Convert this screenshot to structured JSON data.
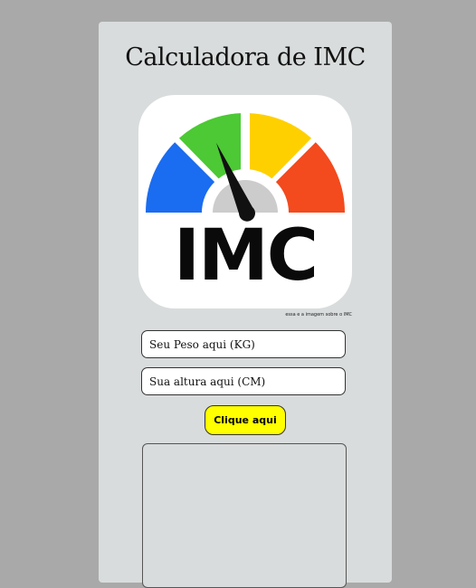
{
  "page": {
    "title": "Calculadora de IMC",
    "logo_text": "IMC",
    "logo_caption": "essa e a imagem sobre o IMC"
  },
  "form": {
    "weight_placeholder": "Seu Peso aqui (KG)",
    "height_placeholder": "Sua altura aqui (CM)",
    "weight_value": "",
    "height_value": "",
    "submit_label": "Clique aqui"
  },
  "result": {
    "text": ""
  },
  "colors": {
    "background": "#a9a9a9",
    "card": "#d9dcdc",
    "button": "#ffff00",
    "gauge_blue": "#1a6cf0",
    "gauge_green": "#4cc934",
    "gauge_yellow": "#ffd000",
    "gauge_red": "#f34a1e"
  },
  "icons": {
    "logo": "bmi-gauge-icon"
  }
}
